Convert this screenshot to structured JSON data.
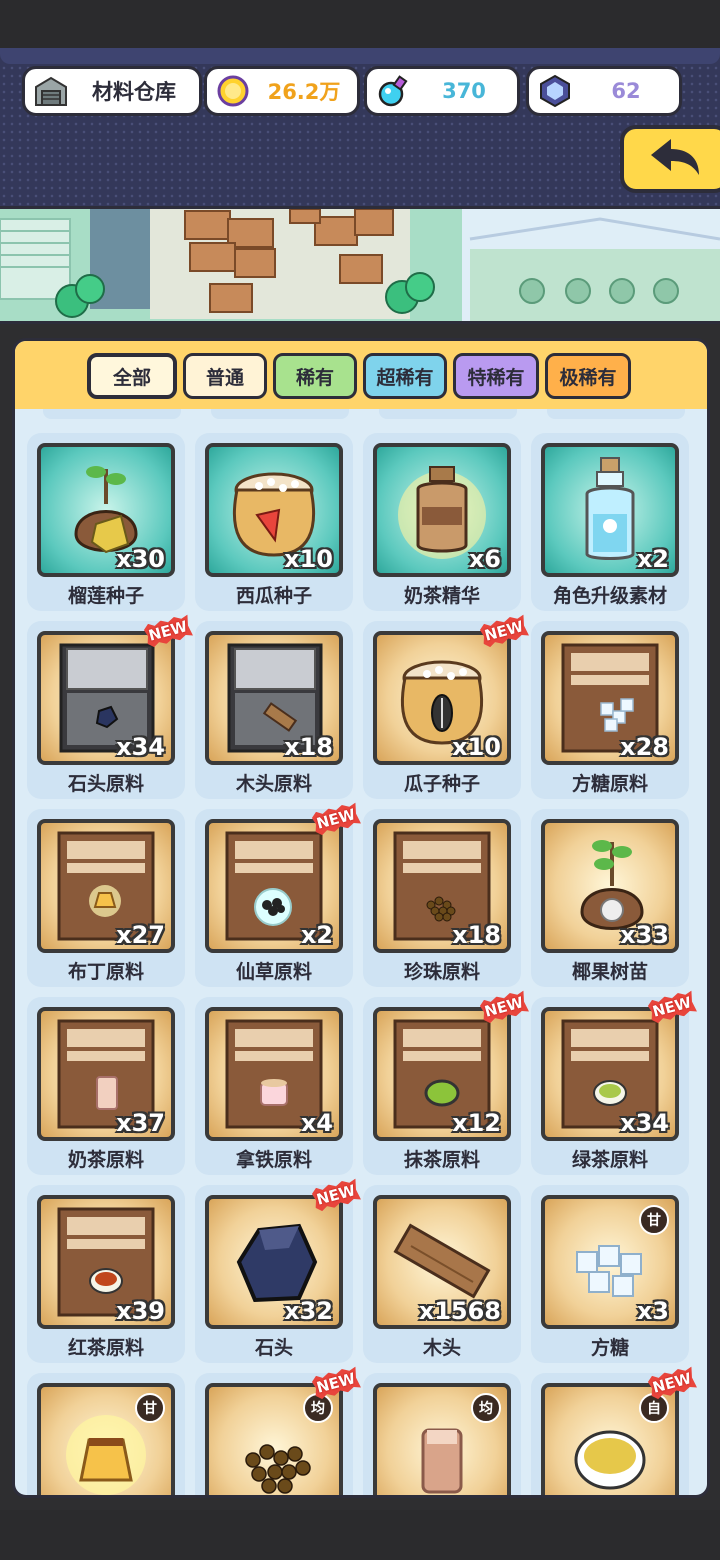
{
  "header": {
    "warehouse_label": "材料仓库",
    "coins": "26.2万",
    "potion": "370",
    "gems": "62"
  },
  "tabs": [
    "全部",
    "普通",
    "稀有",
    "超稀有",
    "特稀有",
    "极稀有"
  ],
  "items": [
    {
      "name": "榴莲种子",
      "qty": "x30",
      "bg": "teal",
      "icon": "durian-seed-icon"
    },
    {
      "name": "西瓜种子",
      "qty": "x10",
      "bg": "teal",
      "icon": "watermelon-seed-sack-icon"
    },
    {
      "name": "奶茶精华",
      "qty": "x6",
      "bg": "teal",
      "icon": "milk-tea-essence-jar-icon"
    },
    {
      "name": "角色升级素材",
      "qty": "x2",
      "bg": "teal",
      "icon": "upgrade-bottle-icon"
    },
    {
      "name": "石头原料",
      "qty": "x34",
      "bg": "gold",
      "icon": "stone-crate-icon",
      "new": true
    },
    {
      "name": "木头原料",
      "qty": "x18",
      "bg": "gold",
      "icon": "wood-crate-icon"
    },
    {
      "name": "瓜子种子",
      "qty": "x10",
      "bg": "gold",
      "icon": "sunflower-seed-sack-icon",
      "new": true
    },
    {
      "name": "方糖原料",
      "qty": "x28",
      "bg": "gold",
      "icon": "sugar-box-icon"
    },
    {
      "name": "布丁原料",
      "qty": "x27",
      "bg": "gold",
      "icon": "pudding-box-icon"
    },
    {
      "name": "仙草原料",
      "qty": "x2",
      "bg": "gold",
      "icon": "grass-jelly-box-icon",
      "new": true
    },
    {
      "name": "珍珠原料",
      "qty": "x18",
      "bg": "gold",
      "icon": "pearl-box-icon"
    },
    {
      "name": "椰果树苗",
      "qty": "x33",
      "bg": "gold",
      "icon": "coconut-sapling-icon"
    },
    {
      "name": "奶茶原料",
      "qty": "x37",
      "bg": "gold",
      "icon": "milk-tea-box-icon"
    },
    {
      "name": "拿铁原料",
      "qty": "x4",
      "bg": "gold",
      "icon": "latte-box-icon"
    },
    {
      "name": "抹茶原料",
      "qty": "x12",
      "bg": "gold",
      "icon": "matcha-box-icon",
      "new": true
    },
    {
      "name": "绿茶原料",
      "qty": "x34",
      "bg": "gold",
      "icon": "green-tea-box-icon",
      "new": true
    },
    {
      "name": "红茶原料",
      "qty": "x39",
      "bg": "gold",
      "icon": "black-tea-box-icon"
    },
    {
      "name": "石头",
      "qty": "x32",
      "bg": "gold",
      "icon": "stone-icon",
      "new": true
    },
    {
      "name": "木头",
      "qty": "x1568",
      "bg": "gold",
      "icon": "wood-plank-icon"
    },
    {
      "name": "方糖",
      "qty": "x3",
      "bg": "gold",
      "icon": "sugar-cubes-icon",
      "tag": "甘"
    },
    {
      "name": "",
      "qty": "",
      "bg": "gold",
      "icon": "pudding-icon",
      "tag": "甘"
    },
    {
      "name": "",
      "qty": "",
      "bg": "gold",
      "icon": "pearls-icon",
      "tag": "均",
      "new": true
    },
    {
      "name": "",
      "qty": "",
      "bg": "gold",
      "icon": "milk-tea-cup-icon",
      "tag": "均"
    },
    {
      "name": "",
      "qty": "",
      "bg": "gold",
      "icon": "tea-cup-icon",
      "tag": "自",
      "new": true
    }
  ],
  "new_badge": "NEW"
}
